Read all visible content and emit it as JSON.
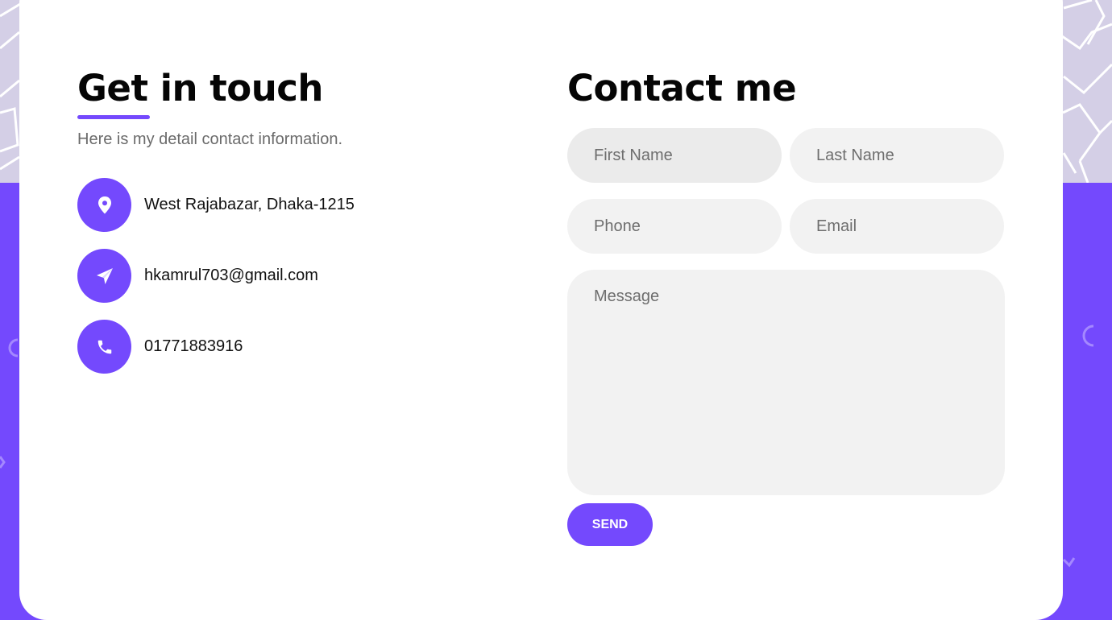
{
  "left": {
    "title": "Get in touch",
    "subtitle": "Here is my detail contact information.",
    "contacts": [
      {
        "icon": "location-pin-icon",
        "text": "West Rajabazar, Dhaka-1215"
      },
      {
        "icon": "paper-plane-icon",
        "text": "hkamrul703@gmail.com"
      },
      {
        "icon": "phone-icon",
        "text": "01771883916"
      }
    ]
  },
  "form": {
    "title": "Contact me",
    "first_name_placeholder": "First Name",
    "last_name_placeholder": "Last Name",
    "phone_placeholder": "Phone",
    "email_placeholder": "Email",
    "message_placeholder": "Message",
    "send_label": "SEND"
  },
  "colors": {
    "accent": "#7449fd",
    "top_background": "#d4cfe6",
    "field_background": "#f2f2f2"
  }
}
